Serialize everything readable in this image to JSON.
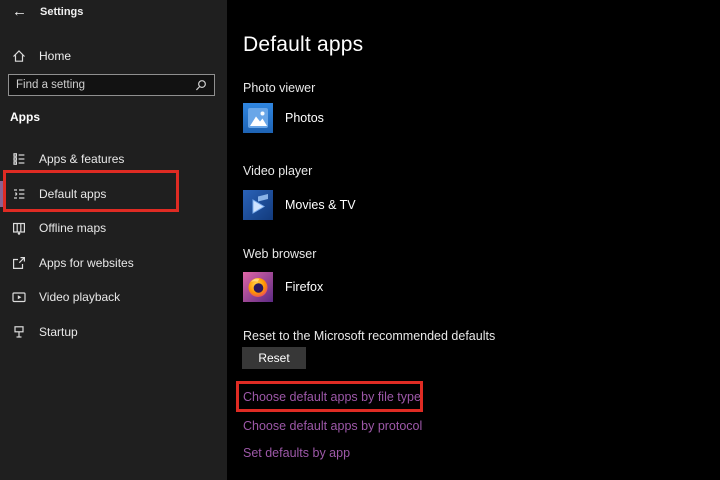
{
  "window": {
    "back_icon": "←",
    "title": "Settings"
  },
  "sidebar": {
    "home_label": "Home",
    "search_placeholder": "Find a setting",
    "search_value": "",
    "section_heading": "Apps",
    "items": [
      {
        "label": "Apps & features",
        "icon": "apps-features-icon",
        "selected": false
      },
      {
        "label": "Default apps",
        "icon": "default-apps-icon",
        "selected": true,
        "annotated": true
      },
      {
        "label": "Offline maps",
        "icon": "offline-maps-icon",
        "selected": false
      },
      {
        "label": "Apps for websites",
        "icon": "apps-for-websites-icon",
        "selected": false
      },
      {
        "label": "Video playback",
        "icon": "video-playback-icon",
        "selected": false
      },
      {
        "label": "Startup",
        "icon": "startup-icon",
        "selected": false
      }
    ]
  },
  "main": {
    "title": "Default apps",
    "categories": [
      {
        "label": "Photo viewer",
        "app": "Photos",
        "icon": "photos-app-icon"
      },
      {
        "label": "Video player",
        "app": "Movies & TV",
        "icon": "movies-tv-app-icon"
      },
      {
        "label": "Web browser",
        "app": "Firefox",
        "icon": "firefox-app-icon"
      }
    ],
    "reset": {
      "description": "Reset to the Microsoft recommended defaults",
      "button_label": "Reset"
    },
    "links": [
      {
        "label": "Choose default apps by file type",
        "annotated": true
      },
      {
        "label": "Choose default apps by protocol",
        "annotated": false
      },
      {
        "label": "Set defaults by app",
        "annotated": false
      }
    ]
  },
  "colors": {
    "main-bg": "#000000",
    "sidebar-bg": "#1f1f1f",
    "accent-link": "#9d58a8",
    "annotation-red": "#df2b23",
    "selection-accent": "#8a6292",
    "reset-button-bg": "#373737"
  }
}
